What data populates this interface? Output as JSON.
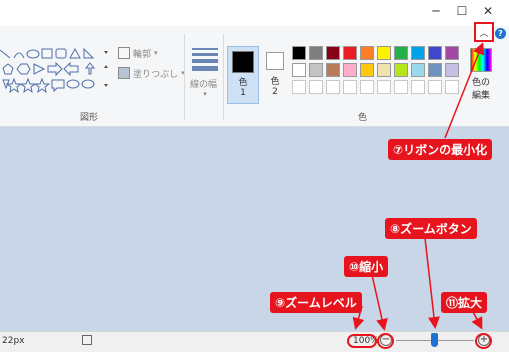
{
  "ribbon": {
    "shapes_group_label": "図形",
    "outline_label": "輪郭",
    "fill_label": "塗りつぶし",
    "line_width_label": "線の幅",
    "color1_label_a": "色",
    "color1_label_b": "1",
    "color2_label_a": "色",
    "color2_label_b": "2",
    "colors_group_label": "色",
    "edit_colors_label_a": "色の",
    "edit_colors_label_b": "編集",
    "palette_row1": [
      "#000000",
      "#7f7f7f",
      "#880015",
      "#ed1c24",
      "#ff7f27",
      "#fff200",
      "#22b14c",
      "#00a2e8",
      "#3f48cc",
      "#a349a4"
    ],
    "palette_row2": [
      "#ffffff",
      "#c3c3c3",
      "#b97a57",
      "#ffaec9",
      "#ffc90e",
      "#efe4b0",
      "#b5e61d",
      "#99d9ea",
      "#7092be",
      "#c8bfe7"
    ]
  },
  "statusbar": {
    "position_text": "22px",
    "zoom_level": "100%"
  },
  "callouts": {
    "minimize_ribbon": "⑦リボンの最小化",
    "zoom_button": "⑧ズームボタン",
    "zoom_level": "⑨ズームレベル",
    "zoom_out": "⑩縮小",
    "zoom_in": "⑪拡大"
  },
  "colors": {
    "accent_red": "#e8141d",
    "canvas_bg": "#c9d6e7",
    "zoom_thumb": "#1e73d2"
  }
}
